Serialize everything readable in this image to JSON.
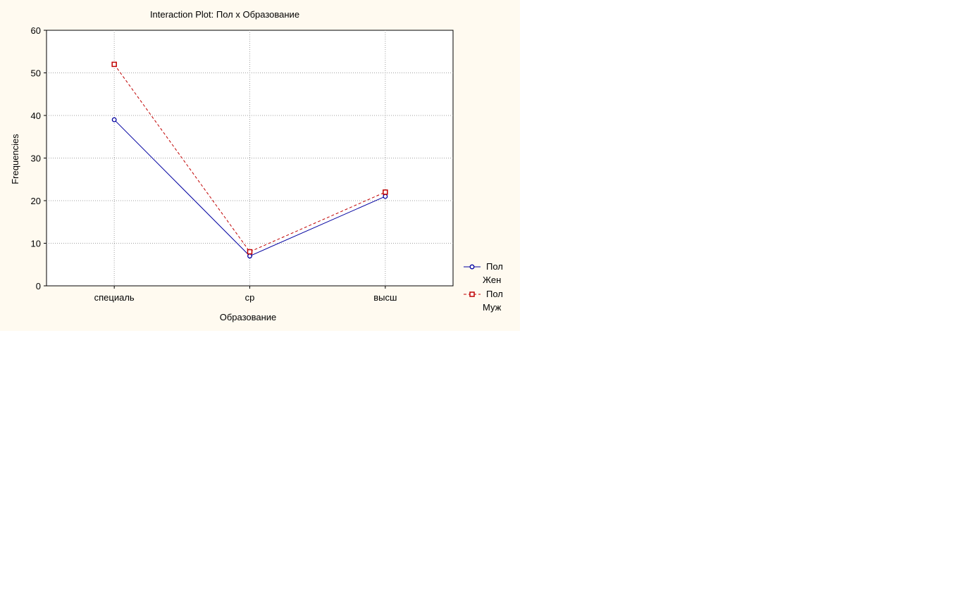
{
  "chart_data": {
    "type": "line",
    "title": "Interaction Plot: Пол x Образование",
    "xlabel": "Образование",
    "ylabel": "Frequencies",
    "categories": [
      "специаль",
      "ср",
      "высш"
    ],
    "ylim": [
      0,
      60
    ],
    "yticks": [
      "0",
      "10",
      "20",
      "30",
      "40",
      "50",
      "60"
    ],
    "grid": true,
    "legend_position": "right-bottom",
    "series": [
      {
        "name": "Пол",
        "sublabel": "Жен",
        "values": [
          39,
          7,
          21
        ],
        "color": "#0000a0",
        "marker": "circle",
        "line": "solid"
      },
      {
        "name": "Пол",
        "sublabel": "Муж",
        "values": [
          52,
          8,
          22
        ],
        "color": "#c00000",
        "marker": "square",
        "line": "dashed"
      }
    ]
  }
}
